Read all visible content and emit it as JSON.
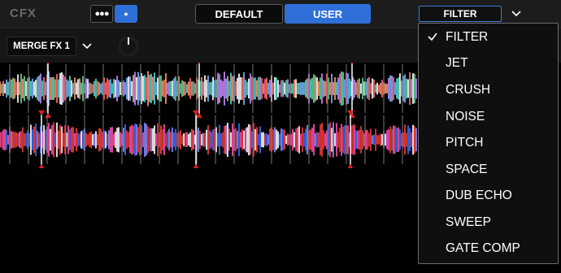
{
  "header": {
    "title": "CFX",
    "dots_label": "●●●",
    "dot_label": "●",
    "tabs": [
      {
        "label": "DEFAULT",
        "active": false
      },
      {
        "label": "USER",
        "active": true
      }
    ],
    "filter_select": {
      "label": "FILTER"
    }
  },
  "fx_bar": {
    "merge_label": "MERGE FX 1"
  },
  "dropdown": {
    "selected": "FILTER",
    "items": [
      "FILTER",
      "JET",
      "CRUSH",
      "NOISE",
      "PITCH",
      "SPACE",
      "DUB ECHO",
      "SWEEP",
      "GATE COMP"
    ]
  },
  "colors": {
    "accent": "#2f6fd8",
    "marker_red": "#e02020",
    "background": "#000000",
    "panel": "#1c1c1c"
  },
  "icons": {
    "dropdown_chevron": "chevron-down-icon",
    "check": "check-icon",
    "knob": "knob-icon"
  }
}
